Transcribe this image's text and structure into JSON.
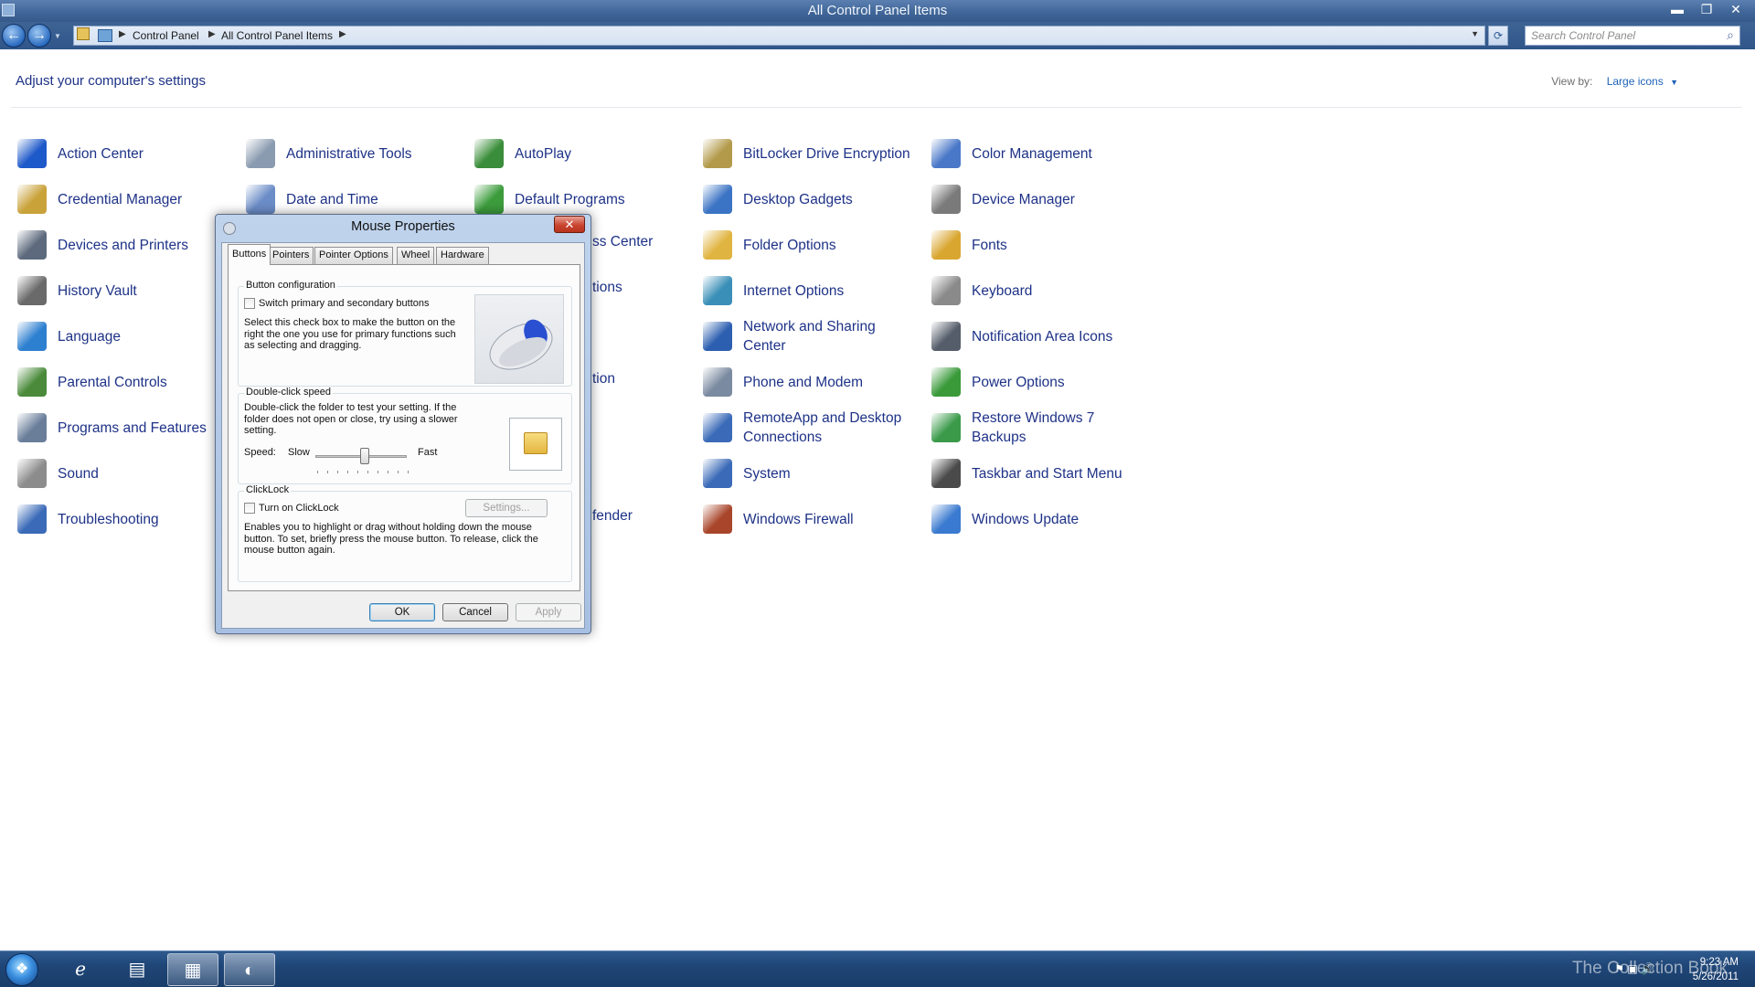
{
  "window": {
    "title": "All Control Panel Items",
    "minimize": "▬",
    "restore": "❐",
    "close": "✕"
  },
  "nav": {
    "back": "←",
    "forward": "→",
    "breadcrumbs": [
      "Control Panel",
      "All Control Panel Items"
    ],
    "search_placeholder": "Search Control Panel"
  },
  "page": {
    "heading": "Adjust your computer's settings",
    "view_by_label": "View by:",
    "view_by_value": "Large icons"
  },
  "items": [
    {
      "label": "Action Center",
      "icon": "flag-icon",
      "color": "#1e59c9"
    },
    {
      "label": "Administrative Tools",
      "icon": "tools-icon",
      "color": "#8a9bb0"
    },
    {
      "label": "AutoPlay",
      "icon": "autoplay-icon",
      "color": "#3a8d3a"
    },
    {
      "label": "BitLocker Drive Encryption",
      "icon": "key-icon",
      "color": "#b39a4a"
    },
    {
      "label": "Color Management",
      "icon": "color-icon",
      "color": "#4a78c8"
    },
    {
      "label": "Credential Manager",
      "icon": "vault-icon",
      "color": "#c9a23a"
    },
    {
      "label": "Date and Time",
      "icon": "clock-icon",
      "color": "#6b8cc7"
    },
    {
      "label": "Default Programs",
      "icon": "default-programs-icon",
      "color": "#3c9c3c"
    },
    {
      "label": "Desktop Gadgets",
      "icon": "gadgets-icon",
      "color": "#3b74c4"
    },
    {
      "label": "Device Manager",
      "icon": "device-manager-icon",
      "color": "#7a7a7a"
    },
    {
      "label": "Devices and Printers",
      "icon": "printer-icon",
      "color": "#5d6a7d"
    },
    {
      "label": "Folder Options",
      "icon": "folder-icon",
      "color": "#e0b440"
    },
    {
      "label": "Fonts",
      "icon": "fonts-icon",
      "color": "#d9a630"
    },
    {
      "label": "History Vault",
      "icon": "history-icon",
      "color": "#6a6a6a"
    },
    {
      "label": "Internet Options",
      "icon": "globe-icon",
      "color": "#3a8fb8"
    },
    {
      "label": "Keyboard",
      "icon": "keyboard-icon",
      "color": "#8a8a8a"
    },
    {
      "label": "Language",
      "icon": "language-icon",
      "color": "#2d7fd0"
    },
    {
      "label": "Network and Sharing Center",
      "icon": "network-icon",
      "color": "#2c5fb0"
    },
    {
      "label": "Notification Area Icons",
      "icon": "notification-icon",
      "color": "#555d6a"
    },
    {
      "label": "Parental Controls",
      "icon": "parental-icon",
      "color": "#4a8a3a"
    },
    {
      "label": "Phone and Modem",
      "icon": "phone-icon",
      "color": "#7a8aa0"
    },
    {
      "label": "Power Options",
      "icon": "power-icon",
      "color": "#3a9a3a"
    },
    {
      "label": "Programs and Features",
      "icon": "programs-icon",
      "color": "#6a7e9a"
    },
    {
      "label": "RemoteApp and Desktop Connections",
      "icon": "remote-icon",
      "color": "#3a6ab8"
    },
    {
      "label": "Restore Windows 7 Backups",
      "icon": "restore-icon",
      "color": "#3a9a4a"
    },
    {
      "label": "Sound",
      "icon": "speaker-icon",
      "color": "#8c8c8c"
    },
    {
      "label": "System",
      "icon": "system-icon",
      "color": "#3a6ab8"
    },
    {
      "label": "Taskbar and Start Menu",
      "icon": "taskbar-icon",
      "color": "#4a4a4a"
    },
    {
      "label": "Troubleshooting",
      "icon": "troubleshoot-icon",
      "color": "#3a6ab8"
    },
    {
      "label": "Windows Firewall",
      "icon": "firewall-icon",
      "color": "#a8452a"
    },
    {
      "label": "Windows Update",
      "icon": "update-icon",
      "color": "#3a7ad0"
    }
  ],
  "hidden_partial": {
    "ease_suffix": "ss Center",
    "options_suffix": "tions",
    "tion_suffix": "tion",
    "defender_suffix": "fender"
  },
  "dialog": {
    "title": "Mouse Properties",
    "tabs": [
      "Buttons",
      "Pointers",
      "Pointer Options",
      "Wheel",
      "Hardware"
    ],
    "button_config": {
      "title": "Button configuration",
      "checkbox_label": "Switch primary and secondary buttons",
      "description": "Select this check box to make the button on the right the one you use for primary functions such as selecting and dragging."
    },
    "double_click": {
      "title": "Double-click speed",
      "description": "Double-click the folder to test your setting. If the folder does not open or close, try using a slower setting.",
      "speed_label": "Speed:",
      "slow": "Slow",
      "fast": "Fast",
      "speed_fraction": 0.55
    },
    "clicklock": {
      "title": "ClickLock",
      "checkbox_label": "Turn on ClickLock",
      "settings_button": "Settings...",
      "description": "Enables you to highlight or drag without holding down the mouse button. To set, briefly press the mouse button. To release, click the mouse button again."
    },
    "ok": "OK",
    "cancel": "Cancel",
    "apply": "Apply"
  },
  "taskbar": {
    "time": "9:23 AM",
    "date": "5/26/2011",
    "watermark": "The Collection Book"
  }
}
